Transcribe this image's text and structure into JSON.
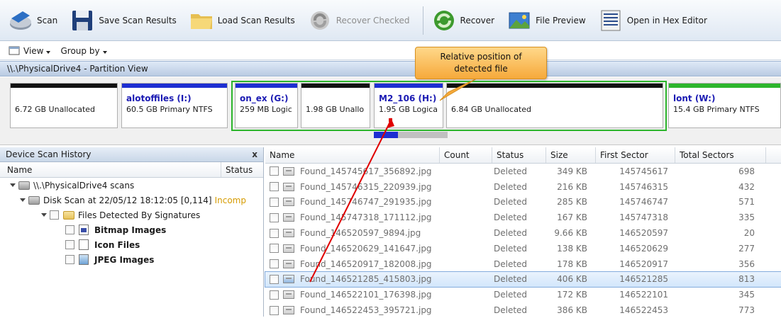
{
  "toolbar": {
    "scan": "Scan",
    "save": "Save Scan Results",
    "load": "Load Scan Results",
    "recover_checked": "Recover Checked",
    "recover": "Recover",
    "file_preview": "File Preview",
    "hex_editor": "Open in Hex Editor"
  },
  "viewbar": {
    "view": "View",
    "group_by": "Group by"
  },
  "partition_header": "\\\\.\\PhysicalDrive4 - Partition View",
  "partitions": [
    {
      "name": "",
      "info": "6.72 GB  Unallocated"
    },
    {
      "name": "alotoffiles (I:)",
      "info": "60.5 GB Primary NTFS"
    },
    {
      "name": "on_ex (G:)",
      "info": "259 MB Logic"
    },
    {
      "name": "",
      "info": "1.98 GB  Unallo"
    },
    {
      "name": "M2_106 (H:)",
      "info": "1.95 GB Logica"
    },
    {
      "name": "",
      "info": "6.84 GB  Unallocated"
    },
    {
      "name": "lont (W:)",
      "info": "15.4 GB Primary NTFS"
    }
  ],
  "callout": {
    "line1": "Relative position of",
    "line2": "detected file"
  },
  "left_panel": {
    "title": "Device Scan History",
    "close": "x",
    "col_name": "Name",
    "col_status": "Status",
    "tree": {
      "root": "\\\\.\\PhysicalDrive4 scans",
      "scan": "Disk Scan at 22/05/12 18:12:05 [0,114]",
      "scan_status": "Incomp",
      "signatures": "Files Detected By Signatures",
      "bitmap": "Bitmap Images",
      "icon": "Icon Files",
      "jpeg": "JPEG Images"
    }
  },
  "file_list": {
    "headers": {
      "name": "Name",
      "count": "Count",
      "status": "Status",
      "size": "Size",
      "first_sector": "First Sector",
      "total_sectors": "Total Sectors"
    },
    "rows": [
      {
        "name": "Found_145745617_356892.jpg",
        "status": "Deleted",
        "size": "349 KB",
        "first": "145745617",
        "total": "698"
      },
      {
        "name": "Found_145746315_220939.jpg",
        "status": "Deleted",
        "size": "216 KB",
        "first": "145746315",
        "total": "432"
      },
      {
        "name": "Found_145746747_291935.jpg",
        "status": "Deleted",
        "size": "285 KB",
        "first": "145746747",
        "total": "571"
      },
      {
        "name": "Found_145747318_171112.jpg",
        "status": "Deleted",
        "size": "167 KB",
        "first": "145747318",
        "total": "335"
      },
      {
        "name": "Found_146520597_9894.jpg",
        "status": "Deleted",
        "size": "9.66 KB",
        "first": "146520597",
        "total": "20"
      },
      {
        "name": "Found_146520629_141647.jpg",
        "status": "Deleted",
        "size": "138 KB",
        "first": "146520629",
        "total": "277"
      },
      {
        "name": "Found_146520917_182008.jpg",
        "status": "Deleted",
        "size": "178 KB",
        "first": "146520917",
        "total": "356"
      },
      {
        "name": "Found_146521285_415803.jpg",
        "status": "Deleted",
        "size": "406 KB",
        "first": "146521285",
        "total": "813"
      },
      {
        "name": "Found_146522101_176398.jpg",
        "status": "Deleted",
        "size": "172 KB",
        "first": "146522101",
        "total": "345"
      },
      {
        "name": "Found_146522453_395721.jpg",
        "status": "Deleted",
        "size": "386 KB",
        "first": "146522453",
        "total": "773"
      }
    ]
  },
  "colors": {
    "accent_blue": "#1d2ed1",
    "frame_green": "#2cb52c",
    "arrow_red": "#e00000",
    "callout_orange": "#f6a93b"
  }
}
